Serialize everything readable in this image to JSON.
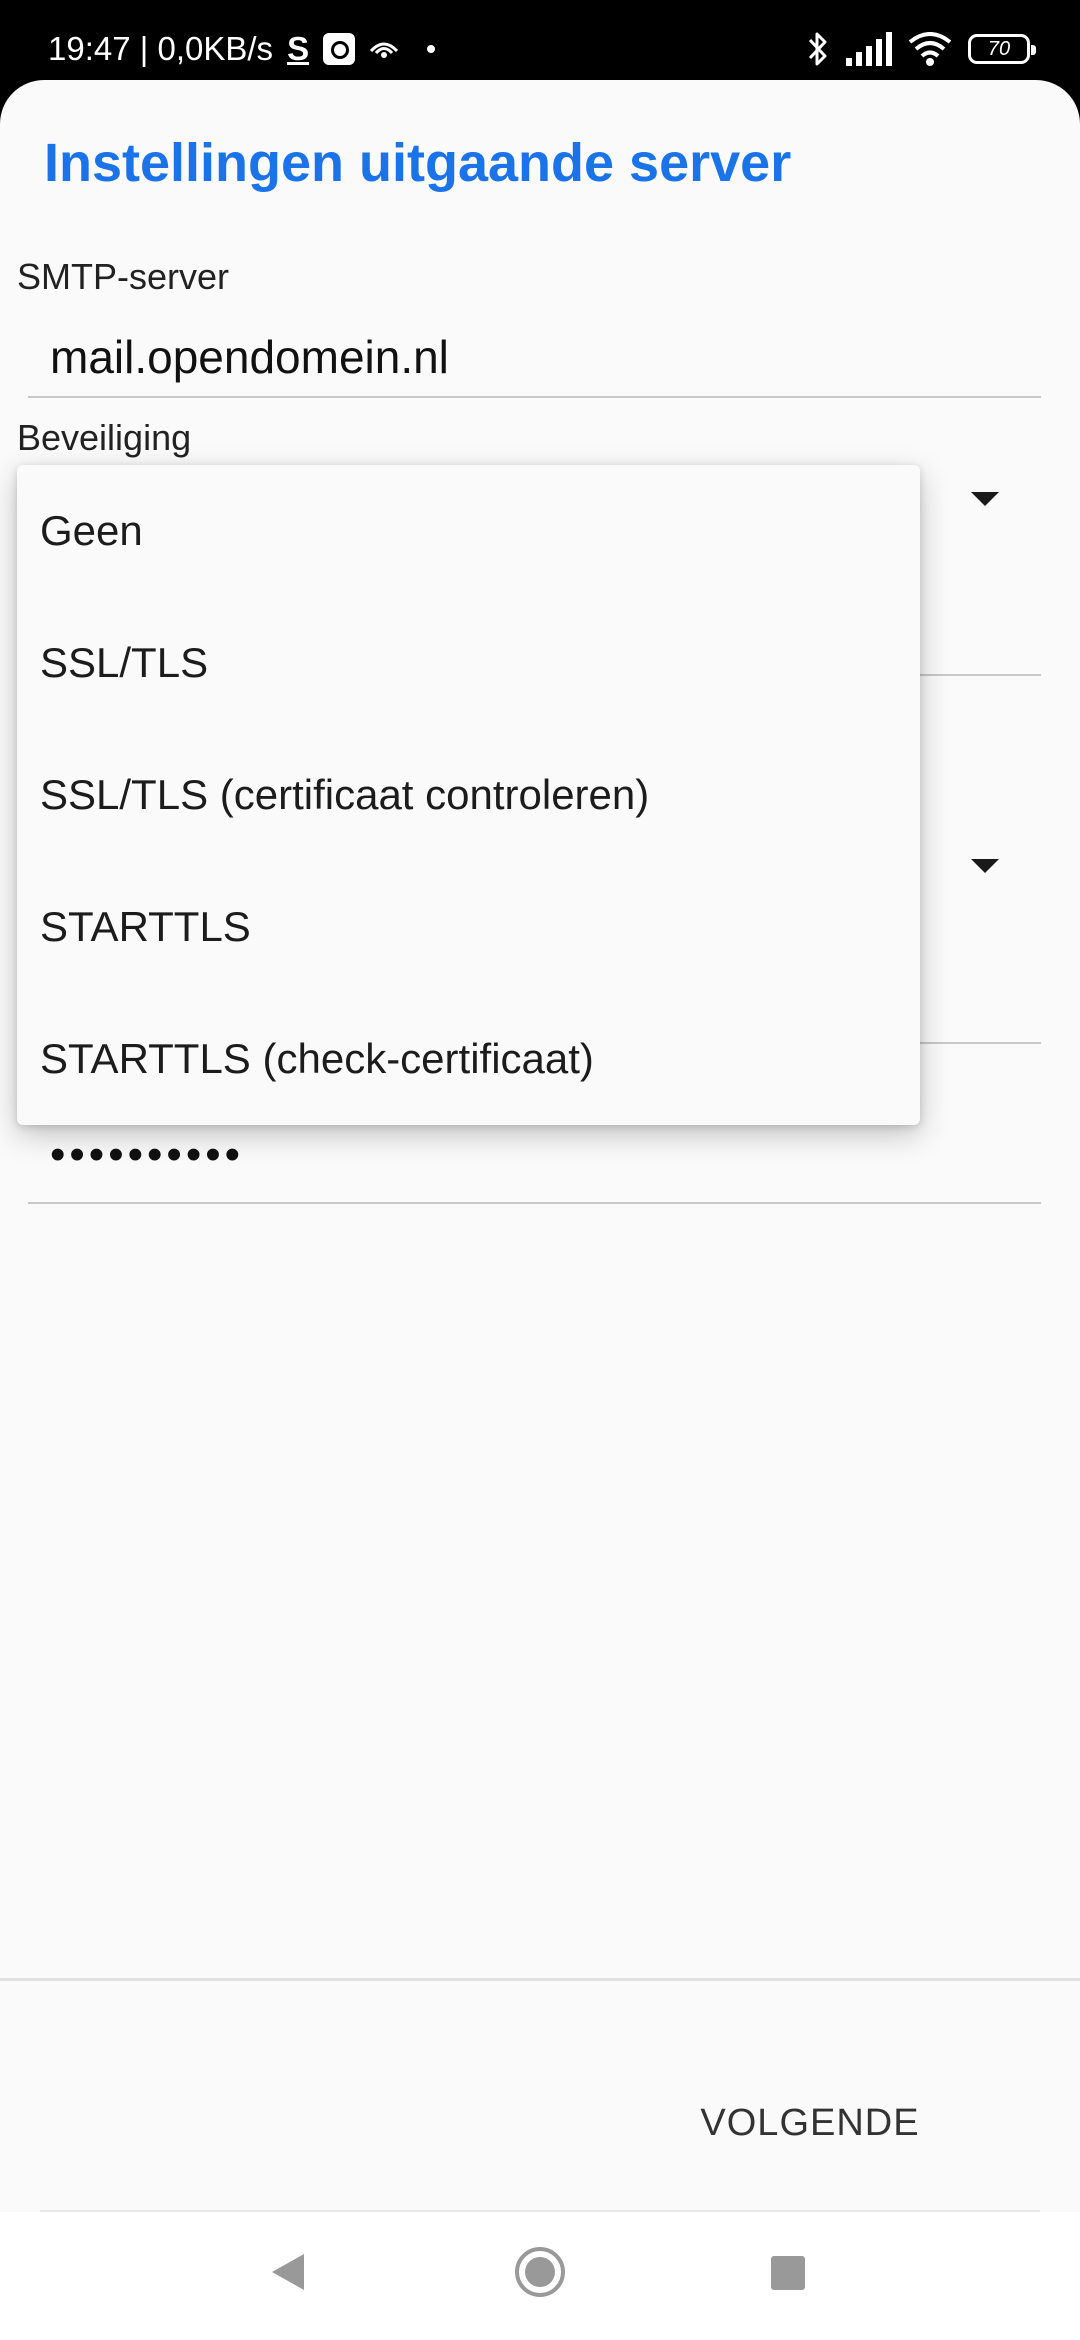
{
  "status_bar": {
    "time_speed": "19:47 | 0,0KB/s",
    "s_glyph": "S",
    "battery_level": "70"
  },
  "title": "Instellingen uitgaande server",
  "form": {
    "smtp_label": "SMTP-server",
    "smtp_value": "mail.opendomein.nl",
    "security_label": "Beveiliging",
    "password_value": "••••••••••"
  },
  "dropdown": {
    "options": [
      "Geen",
      "SSL/TLS",
      "SSL/TLS (certificaat controleren)",
      "STARTTLS",
      "STARTTLS (check-certificaat)"
    ]
  },
  "actions": {
    "next_label": "VOLGENDE"
  },
  "colors": {
    "accent": "#1a73e8",
    "background": "#fafafa"
  }
}
